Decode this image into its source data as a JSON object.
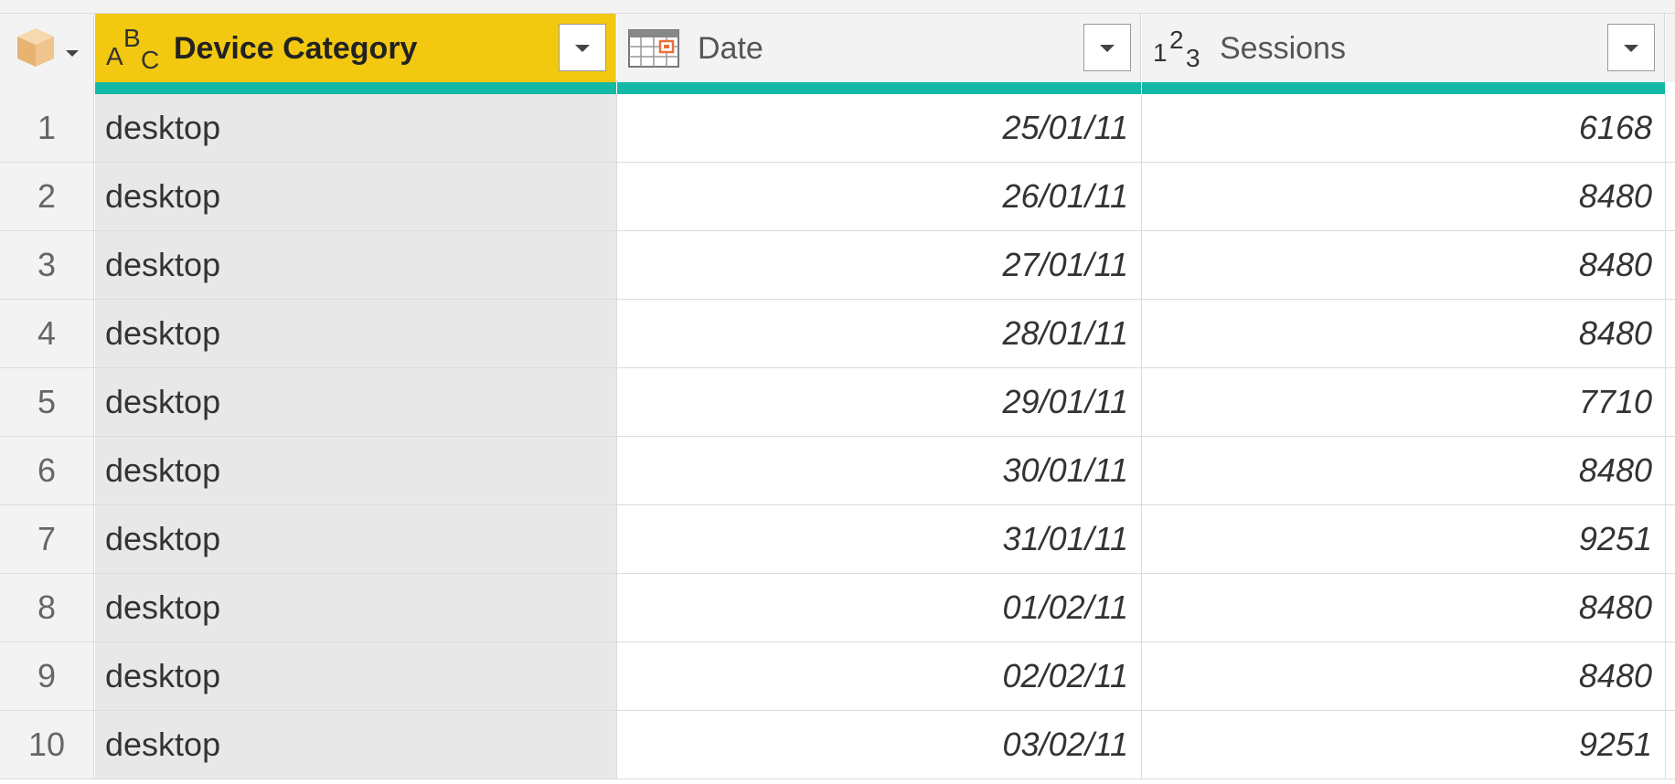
{
  "header": {
    "columns": [
      {
        "label": "Device Category",
        "type_icon": "abc-text-type-icon"
      },
      {
        "label": "Date",
        "type_icon": "calendar-date-type-icon"
      },
      {
        "label": "Sessions",
        "type_icon": "123-number-type-icon"
      }
    ],
    "corner_icon": "table-menu-icon",
    "type_glyphs": {
      "text_a": "A",
      "text_b": "B",
      "text_c": "C",
      "num_1": "1",
      "num_2": "2",
      "num_3": "3"
    }
  },
  "colors": {
    "selected_header": "#f2c811",
    "column_quality_bar": "#14b8a6"
  },
  "rows": [
    {
      "index": "1",
      "device": "desktop",
      "date": "25/01/11",
      "sessions": "6168"
    },
    {
      "index": "2",
      "device": "desktop",
      "date": "26/01/11",
      "sessions": "8480"
    },
    {
      "index": "3",
      "device": "desktop",
      "date": "27/01/11",
      "sessions": "8480"
    },
    {
      "index": "4",
      "device": "desktop",
      "date": "28/01/11",
      "sessions": "8480"
    },
    {
      "index": "5",
      "device": "desktop",
      "date": "29/01/11",
      "sessions": "7710"
    },
    {
      "index": "6",
      "device": "desktop",
      "date": "30/01/11",
      "sessions": "8480"
    },
    {
      "index": "7",
      "device": "desktop",
      "date": "31/01/11",
      "sessions": "9251"
    },
    {
      "index": "8",
      "device": "desktop",
      "date": "01/02/11",
      "sessions": "8480"
    },
    {
      "index": "9",
      "device": "desktop",
      "date": "02/02/11",
      "sessions": "8480"
    },
    {
      "index": "10",
      "device": "desktop",
      "date": "03/02/11",
      "sessions": "9251"
    }
  ]
}
